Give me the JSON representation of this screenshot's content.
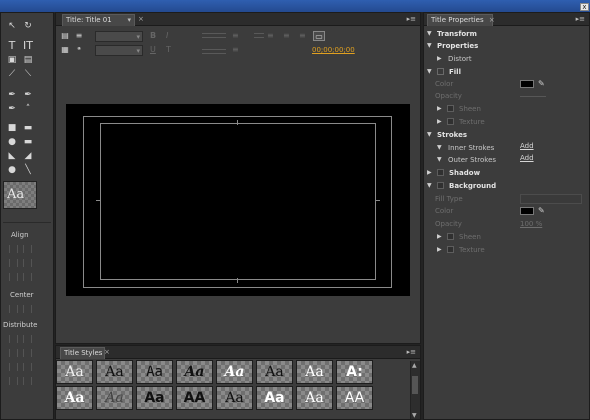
{
  "window": {
    "close_label": "x"
  },
  "tools_panel": {
    "items": [
      "selection-tool",
      "rotation-tool",
      "type-tool",
      "vertical-type-tool",
      "area-type-tool",
      "vertical-area-type-tool",
      "path-type-tool",
      "vertical-path-type-tool",
      "pen-tool",
      "delete-anchor-tool",
      "add-anchor-tool",
      "convert-anchor-tool",
      "rectangle-tool",
      "rounded-rectangle-tool",
      "clipped-corner-tool",
      "rounded-corner-tool",
      "wedge-tool",
      "arc-tool",
      "ellipse-tool",
      "line-tool"
    ],
    "preview_label": "Aa",
    "align_label": "Align",
    "center_label": "Center",
    "distribute_label": "Distribute"
  },
  "title_panel": {
    "tab_label": "Title: Title 01",
    "timecode": "00;00;00;00"
  },
  "styles_panel": {
    "tab_label": "Title Styles",
    "styles": [
      "Aa",
      "Aa",
      "Aa",
      "Aa",
      "Aa",
      "Aa",
      "Aa",
      "A:",
      "Aa",
      "Aa",
      "Aa",
      "AA",
      "Aa",
      "Aa",
      "Aa",
      "AA"
    ]
  },
  "properties_panel": {
    "tab_label": "Title Properties",
    "rows": {
      "transform": "Transform",
      "properties": "Properties",
      "distort": "Distort",
      "fill": "Fill",
      "color": "Color",
      "opacity": "Opacity",
      "sheen": "Sheen",
      "texture": "Texture",
      "strokes": "Strokes",
      "inner_strokes": "Inner Strokes",
      "outer_strokes": "Outer Strokes",
      "add": "Add",
      "shadow": "Shadow",
      "background": "Background",
      "fill_type": "Fill Type",
      "bg_color": "Color",
      "bg_opacity": "Opacity",
      "bg_opacity_value": "100 %",
      "bg_sheen": "Sheen",
      "bg_texture": "Texture"
    }
  },
  "colors": {
    "accent_timecode": "#e0a020",
    "canvas": "#000000"
  }
}
